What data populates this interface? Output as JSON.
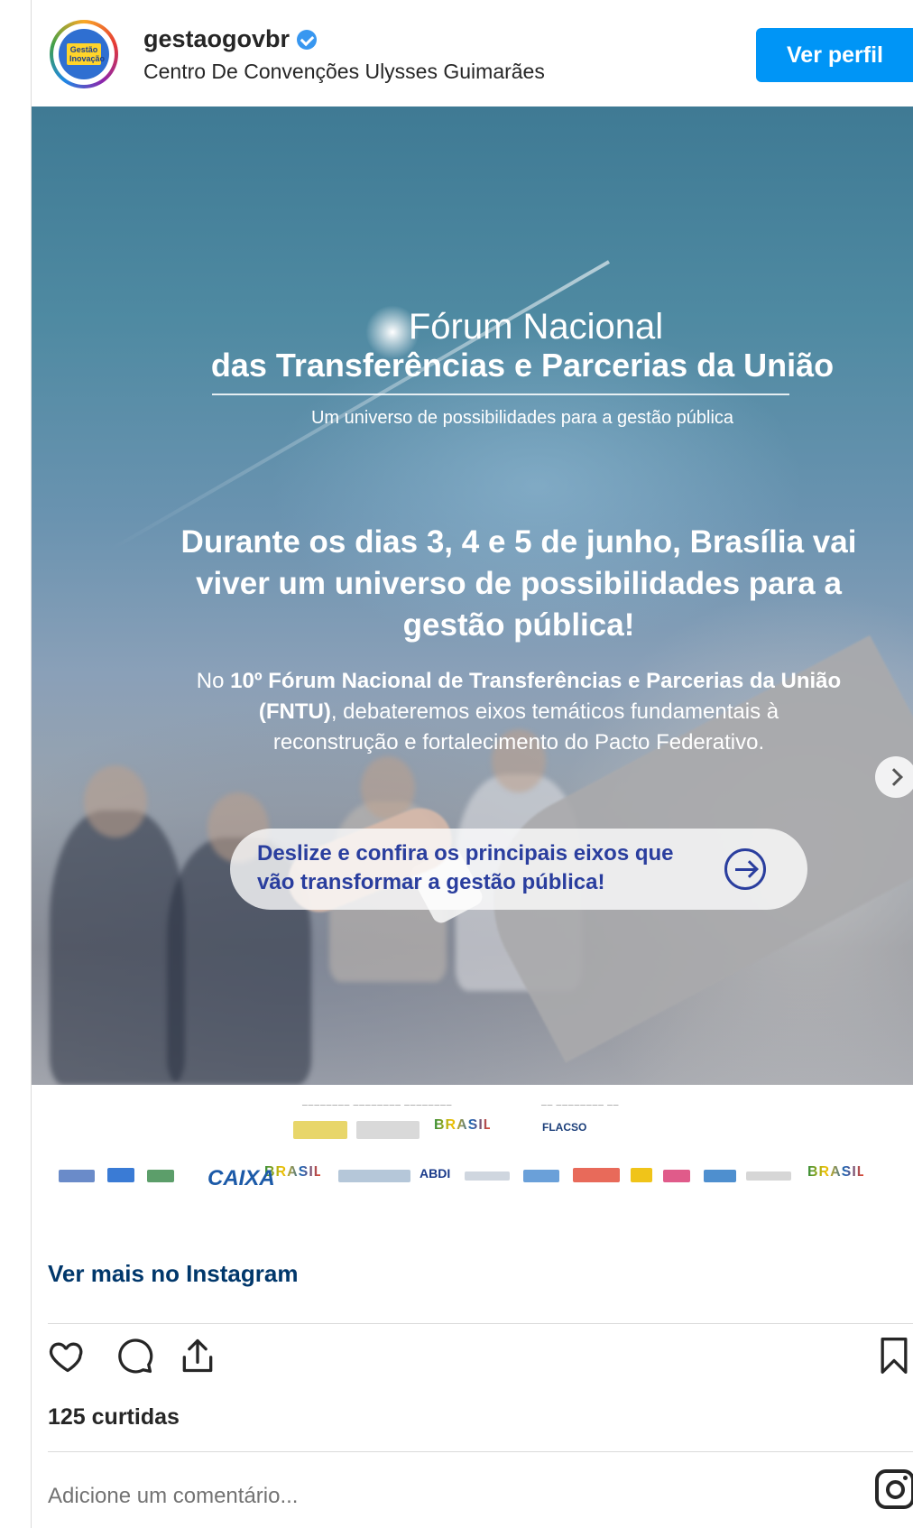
{
  "header": {
    "username": "gestaogovbr",
    "location": "Centro De Convenções Ulysses Guimarães",
    "follow_button": "Ver perfil",
    "avatar_text": "Gestão Inovação"
  },
  "post": {
    "forum_title_line1": "Fórum Nacional",
    "forum_title_line2": "das Transferências e Parcerias da União",
    "forum_subtitle": "Um universo de possibilidades para a gestão pública",
    "headline": "Durante os dias 3, 4 e 5 de junho, Brasília vai viver um universo de possibilidades para a gestão pública!",
    "body_prefix": "No ",
    "body_bold": "10º Fórum Nacional de Transferências e Parcerias da União (FNTU)",
    "body_suffix": ", debateremos eixos temáticos fundamentais à reconstrução e fortalecimento do Pacto Federativo.",
    "cta": "Deslize e confira os principais eixos que vão transformar a gestão pública!",
    "sponsors": {
      "caixa": "CAIXA",
      "brasil": "BRASIL",
      "flacso": "FLACSO",
      "abdi": "ABDI"
    }
  },
  "footer": {
    "see_more": "Ver mais no Instagram",
    "likes": "125 curtidas",
    "comment_placeholder": "Adicione um comentário..."
  },
  "colors": {
    "primary_button": "#0095f6",
    "link": "#00376b",
    "cta_text": "#2a3e9e"
  }
}
